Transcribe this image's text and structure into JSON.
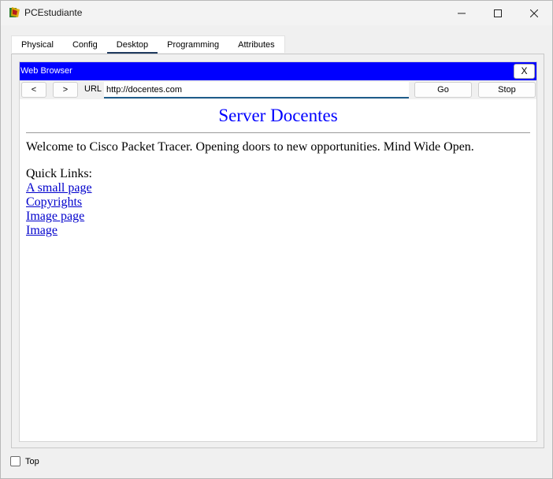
{
  "window": {
    "title": "PCEstudiante"
  },
  "tabs": [
    {
      "label": "Physical"
    },
    {
      "label": "Config"
    },
    {
      "label": "Desktop",
      "active": true
    },
    {
      "label": "Programming"
    },
    {
      "label": "Attributes"
    }
  ],
  "browser": {
    "title": "Web Browser",
    "close_label": "X",
    "back_label": "<",
    "forward_label": ">",
    "url_label": "URL",
    "url_value": "http://docentes.com",
    "go_label": "Go",
    "stop_label": "Stop"
  },
  "page": {
    "heading": "Server Docentes",
    "welcome": "Welcome to Cisco Packet Tracer. Opening doors to new opportunities. Mind Wide Open.",
    "quick_links_label": "Quick Links:",
    "links": [
      {
        "label": "A small page"
      },
      {
        "label": "Copyrights"
      },
      {
        "label": "Image page"
      },
      {
        "label": "Image"
      }
    ]
  },
  "bottom": {
    "top_label": "Top",
    "top_checked": false
  },
  "colors": {
    "browser_header": "#0000ff",
    "heading": "#0000ff",
    "link": "#0000cc",
    "active_tab_indicator": "#1f3a5f"
  },
  "icons": {
    "app": "packet-tracer-pc-icon",
    "minimize": "minimize-icon",
    "maximize": "maximize-icon",
    "close": "close-icon"
  }
}
